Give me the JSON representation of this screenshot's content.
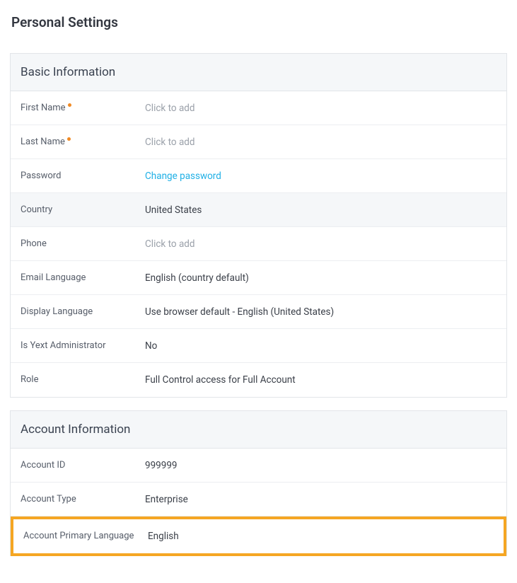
{
  "page": {
    "title": "Personal Settings"
  },
  "basicInfo": {
    "header": "Basic Information",
    "firstName": {
      "label": "First Name",
      "placeholder": "Click to add",
      "required": true
    },
    "lastName": {
      "label": "Last Name",
      "placeholder": "Click to add",
      "required": true
    },
    "password": {
      "label": "Password",
      "linkText": "Change password"
    },
    "country": {
      "label": "Country",
      "value": "United States"
    },
    "phone": {
      "label": "Phone",
      "placeholder": "Click to add"
    },
    "emailLanguage": {
      "label": "Email Language",
      "value": "English (country default)"
    },
    "displayLanguage": {
      "label": "Display Language",
      "value": "Use browser default - English (United States)"
    },
    "isAdmin": {
      "label": "Is Yext Administrator",
      "value": "No"
    },
    "role": {
      "label": "Role",
      "value": "Full Control access for Full Account"
    }
  },
  "accountInfo": {
    "header": "Account Information",
    "accountId": {
      "label": "Account ID",
      "value": "999999"
    },
    "accountType": {
      "label": "Account Type",
      "value": "Enterprise"
    },
    "primaryLanguage": {
      "label": "Account Primary Language",
      "value": "English"
    }
  }
}
